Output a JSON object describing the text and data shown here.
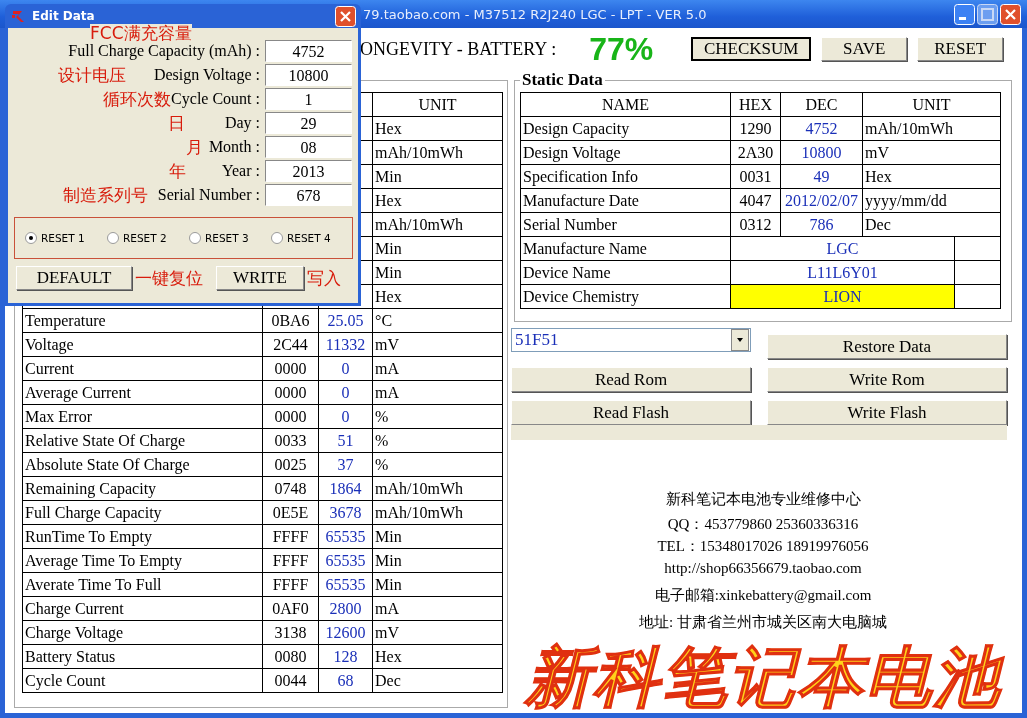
{
  "window": {
    "title": "79.taobao.com - M37512 R2J240 LGC - LPT - VER 5.0"
  },
  "header": {
    "label": "ONGEVITY - BATTERY :",
    "percent": "77%",
    "buttons": [
      "CHECKSUM",
      "SAVE",
      "RESET"
    ]
  },
  "dynamic_table": {
    "columns": [
      "UNIT"
    ],
    "rows": [
      {
        "unit": "Hex"
      },
      {
        "unit": "mAh/10mWh"
      },
      {
        "unit": "Min"
      },
      {
        "unit": "Hex"
      },
      {
        "unit": "mAh/10mWh"
      },
      {
        "unit": "Min"
      },
      {
        "unit": "Min"
      },
      {
        "unit": "Hex"
      },
      {
        "name": "Temperature",
        "hex": "0BA6",
        "dec": "25.05",
        "unit": "°C"
      },
      {
        "name": "Voltage",
        "hex": "2C44",
        "dec": "11332",
        "unit": "mV"
      },
      {
        "name": "Current",
        "hex": "0000",
        "dec": "0",
        "unit": "mA"
      },
      {
        "name": "Average Current",
        "hex": "0000",
        "dec": "0",
        "unit": "mA"
      },
      {
        "name": "Max Error",
        "hex": "0000",
        "dec": "0",
        "unit": "%"
      },
      {
        "name": "Relative State Of Charge",
        "hex": "0033",
        "dec": "51",
        "unit": "%"
      },
      {
        "name": "Absolute State Of Charge",
        "hex": "0025",
        "dec": "37",
        "unit": "%"
      },
      {
        "name": "Remaining Capacity",
        "hex": "0748",
        "dec": "1864",
        "unit": "mAh/10mWh"
      },
      {
        "name": "Full Charge Capacity",
        "hex": "0E5E",
        "dec": "3678",
        "unit": "mAh/10mWh"
      },
      {
        "name": "RunTime To Empty",
        "hex": "FFFF",
        "dec": "65535",
        "unit": "Min"
      },
      {
        "name": "Average Time To Empty",
        "hex": "FFFF",
        "dec": "65535",
        "unit": "Min"
      },
      {
        "name": "Averate Time To Full",
        "hex": "FFFF",
        "dec": "65535",
        "unit": "Min"
      },
      {
        "name": "Charge Current",
        "hex": "0AF0",
        "dec": "2800",
        "unit": "mA"
      },
      {
        "name": "Charge Voltage",
        "hex": "3138",
        "dec": "12600",
        "unit": "mV"
      },
      {
        "name": "Battery Status",
        "hex": "0080",
        "dec": "128",
        "unit": "Hex"
      },
      {
        "name": "Cycle Count",
        "hex": "0044",
        "dec": "68",
        "unit": "Dec"
      }
    ]
  },
  "static_data": {
    "title": "Static Data",
    "columns": [
      "NAME",
      "HEX",
      "DEC",
      "UNIT"
    ],
    "rows": [
      {
        "kind": "numeric",
        "name": "Design Capacity",
        "hex": "1290",
        "dec": "4752",
        "unit": "mAh/10mWh"
      },
      {
        "kind": "numeric",
        "name": "Design Voltage",
        "hex": "2A30",
        "dec": "10800",
        "unit": "mV"
      },
      {
        "kind": "numeric",
        "name": "Specification Info",
        "hex": "0031",
        "dec": "49",
        "unit": "Hex"
      },
      {
        "kind": "numeric",
        "name": "Manufacture Date",
        "hex": "4047",
        "dec": "2012/02/07",
        "unit": "yyyy/mm/dd"
      },
      {
        "kind": "numeric",
        "name": "Serial Number",
        "hex": "0312",
        "dec": "786",
        "unit": "Dec"
      },
      {
        "kind": "text",
        "name": "Manufacture Name",
        "value": "LGC",
        "highlighted": false
      },
      {
        "kind": "text",
        "name": "Device Name",
        "value": "L11L6Y01",
        "highlighted": false
      },
      {
        "kind": "text",
        "name": "Device Chemistry",
        "value": "LION",
        "highlighted": true
      }
    ]
  },
  "controls": {
    "dropdown": {
      "value": "51F51"
    },
    "buttons": [
      "Restore Data",
      "Read Rom",
      "Write Rom",
      "Read Flash",
      "Write Flash"
    ],
    "progress": {
      "level": 0
    }
  },
  "contact": [
    "新科笔记本电池专业维修中心",
    "QQ：453779860  25360336316",
    "TEL：15348017026  18919976056",
    "http://shop66356679.taobao.com",
    "电子邮箱:xinkebattery@gmail.com",
    "地址: 甘肃省兰州市城关区南大电脑城"
  ],
  "banner": "新科笔记本电池",
  "edit_dialog": {
    "title": "Edit Data",
    "note": "FCC满充容量",
    "fields": [
      {
        "label": "Full Charge Capacity (mAh) :",
        "value": "4752"
      },
      {
        "label": "Design Voltage :",
        "value": "10800",
        "annotation": "设计电压"
      },
      {
        "label": "Cycle Count :",
        "value": "1",
        "annotation": "循环次数"
      },
      {
        "label": "Day :",
        "value": "29",
        "annotation": "日"
      },
      {
        "label": "Month :",
        "value": "08",
        "annotation": "月"
      },
      {
        "label": "Year :",
        "value": "2013",
        "annotation": "年"
      },
      {
        "label": "Serial Number :",
        "value": "678",
        "annotation": "制造系列号"
      }
    ],
    "resets": [
      {
        "label": "RESET 1",
        "selected": true
      },
      {
        "label": "RESET 2",
        "selected": false
      },
      {
        "label": "RESET 3",
        "selected": false
      },
      {
        "label": "RESET 4",
        "selected": false
      }
    ],
    "buttons": [
      {
        "label": "DEFAULT",
        "annotation": "一键复位"
      },
      {
        "label": "WRITE",
        "annotation": "写入"
      }
    ]
  }
}
